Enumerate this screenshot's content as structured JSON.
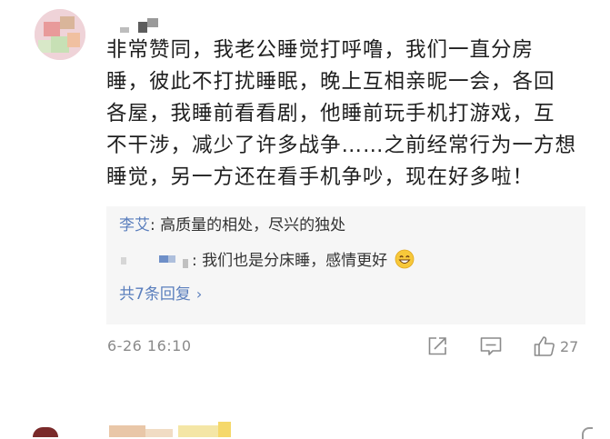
{
  "comment": {
    "avatar_icon": "pixelated-avatar-icon",
    "username": "",
    "body_lines": [
      "非常赞同，我老公睡觉打呼噜，我们一直分房",
      "睡，彼此不打扰睡眠，晚上互相亲昵一会，各回",
      "各屋，我睡前看看剧，他睡前玩手机打游戏，互",
      "不干涉，减少了许多战争……之前经常行为一方想",
      "睡觉，另一方还在看手机争吵，现在好多啦！"
    ],
    "replies": [
      {
        "name": "李艾",
        "separator": ": ",
        "text": "高质量的相处，尽兴的独处"
      },
      {
        "name": "",
        "separator": ": ",
        "text": "我们也是分床睡，感情更好",
        "emoji": "grinning-face-emoji"
      }
    ],
    "more_replies_label": "共7条回复",
    "more_replies_chevron": "›",
    "timestamp": "6-26 16:10",
    "actions": {
      "share_icon": "share-icon",
      "comment_icon": "comment-icon",
      "like_icon": "thumbs-up-icon",
      "like_count": "27"
    }
  },
  "colors": {
    "link_blue": "#5b7fbd",
    "reply_bg": "#f6f6f6",
    "meta_gray": "#8a8a8a",
    "body_text": "#1f1f1f"
  }
}
